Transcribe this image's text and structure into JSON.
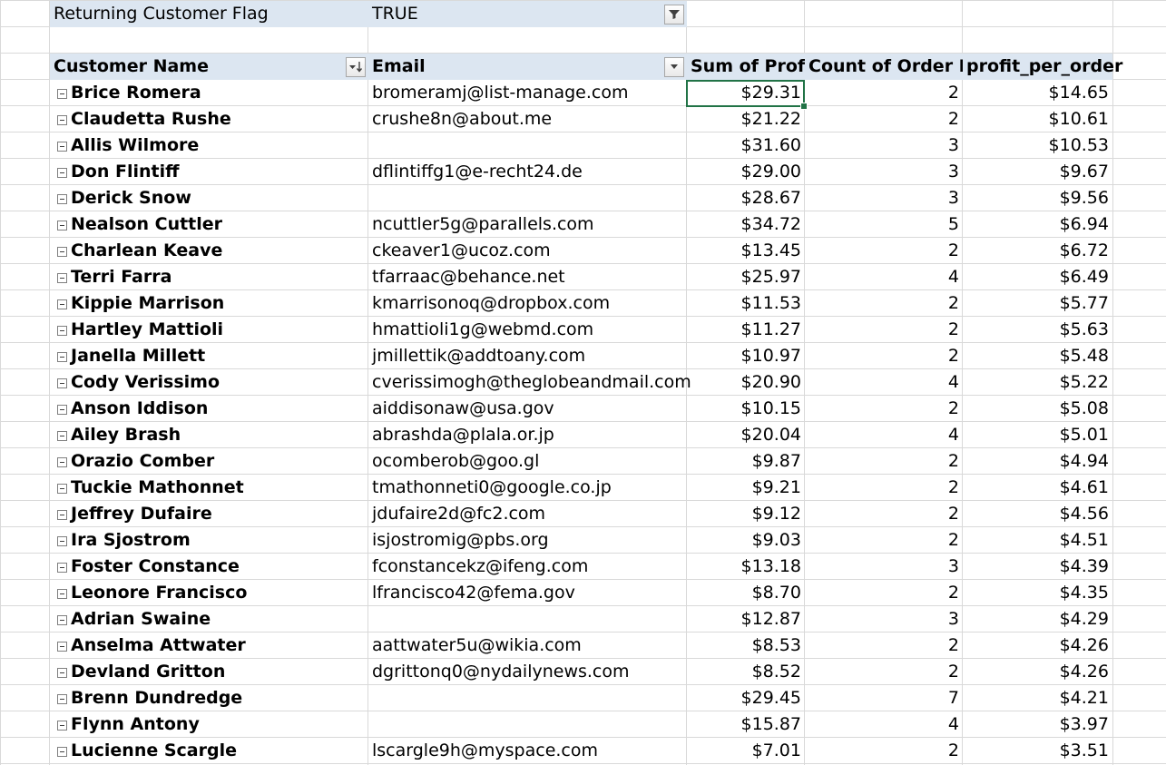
{
  "filter": {
    "label": "Returning Customer Flag",
    "value": "TRUE"
  },
  "headers": {
    "customer_name": "Customer Name",
    "email": "Email",
    "sum_profit": "Sum of Profit",
    "count_order": "Count of Order ID",
    "profit_per_order": "profit_per_order"
  },
  "icons": {
    "filter_button": "filter-funnel-icon",
    "sort_button": "sort-descending-dropdown-icon",
    "email_dropdown": "dropdown-arrow-icon",
    "row_toggle": "collapse-minus-icon"
  },
  "rows": [
    {
      "name": "Brice Romera",
      "email": "bromeramj@list-manage.com",
      "profit": "$29.31",
      "count": "2",
      "ppo": "$14.65"
    },
    {
      "name": "Claudetta Rushe",
      "email": "crushe8n@about.me",
      "profit": "$21.22",
      "count": "2",
      "ppo": "$10.61"
    },
    {
      "name": "Allis Wilmore",
      "email": "",
      "profit": "$31.60",
      "count": "3",
      "ppo": "$10.53"
    },
    {
      "name": "Don Flintiff",
      "email": "dflintiffg1@e-recht24.de",
      "profit": "$29.00",
      "count": "3",
      "ppo": "$9.67"
    },
    {
      "name": "Derick Snow",
      "email": "",
      "profit": "$28.67",
      "count": "3",
      "ppo": "$9.56"
    },
    {
      "name": "Nealson Cuttler",
      "email": "ncuttler5g@parallels.com",
      "profit": "$34.72",
      "count": "5",
      "ppo": "$6.94"
    },
    {
      "name": "Charlean Keave",
      "email": "ckeaver1@ucoz.com",
      "profit": "$13.45",
      "count": "2",
      "ppo": "$6.72"
    },
    {
      "name": "Terri Farra",
      "email": "tfarraac@behance.net",
      "profit": "$25.97",
      "count": "4",
      "ppo": "$6.49"
    },
    {
      "name": "Kippie Marrison",
      "email": "kmarrisonoq@dropbox.com",
      "profit": "$11.53",
      "count": "2",
      "ppo": "$5.77"
    },
    {
      "name": "Hartley Mattioli",
      "email": "hmattioli1g@webmd.com",
      "profit": "$11.27",
      "count": "2",
      "ppo": "$5.63"
    },
    {
      "name": "Janella Millett",
      "email": "jmillettik@addtoany.com",
      "profit": "$10.97",
      "count": "2",
      "ppo": "$5.48"
    },
    {
      "name": "Cody Verissimo",
      "email": "cverissimogh@theglobeandmail.com",
      "profit": "$20.90",
      "count": "4",
      "ppo": "$5.22"
    },
    {
      "name": "Anson Iddison",
      "email": "aiddisonaw@usa.gov",
      "profit": "$10.15",
      "count": "2",
      "ppo": "$5.08"
    },
    {
      "name": "Ailey Brash",
      "email": "abrashda@plala.or.jp",
      "profit": "$20.04",
      "count": "4",
      "ppo": "$5.01"
    },
    {
      "name": "Orazio Comber",
      "email": "ocomberob@goo.gl",
      "profit": "$9.87",
      "count": "2",
      "ppo": "$4.94"
    },
    {
      "name": "Tuckie Mathonnet",
      "email": "tmathonneti0@google.co.jp",
      "profit": "$9.21",
      "count": "2",
      "ppo": "$4.61"
    },
    {
      "name": "Jeffrey Dufaire",
      "email": "jdufaire2d@fc2.com",
      "profit": "$9.12",
      "count": "2",
      "ppo": "$4.56"
    },
    {
      "name": "Ira Sjostrom",
      "email": "isjostromig@pbs.org",
      "profit": "$9.03",
      "count": "2",
      "ppo": "$4.51"
    },
    {
      "name": "Foster Constance",
      "email": "fconstancekz@ifeng.com",
      "profit": "$13.18",
      "count": "3",
      "ppo": "$4.39"
    },
    {
      "name": "Leonore Francisco",
      "email": "lfrancisco42@fema.gov",
      "profit": "$8.70",
      "count": "2",
      "ppo": "$4.35"
    },
    {
      "name": "Adrian Swaine",
      "email": "",
      "profit": "$12.87",
      "count": "3",
      "ppo": "$4.29"
    },
    {
      "name": "Anselma Attwater",
      "email": "aattwater5u@wikia.com",
      "profit": "$8.53",
      "count": "2",
      "ppo": "$4.26"
    },
    {
      "name": "Devland Gritton",
      "email": "dgrittonq0@nydailynews.com",
      "profit": "$8.52",
      "count": "2",
      "ppo": "$4.26"
    },
    {
      "name": "Brenn Dundredge",
      "email": "",
      "profit": "$29.45",
      "count": "7",
      "ppo": "$4.21"
    },
    {
      "name": "Flynn Antony",
      "email": "",
      "profit": "$15.87",
      "count": "4",
      "ppo": "$3.97"
    },
    {
      "name": "Lucienne Scargle",
      "email": "lscargle9h@myspace.com",
      "profit": "$7.01",
      "count": "2",
      "ppo": "$3.51"
    }
  ]
}
